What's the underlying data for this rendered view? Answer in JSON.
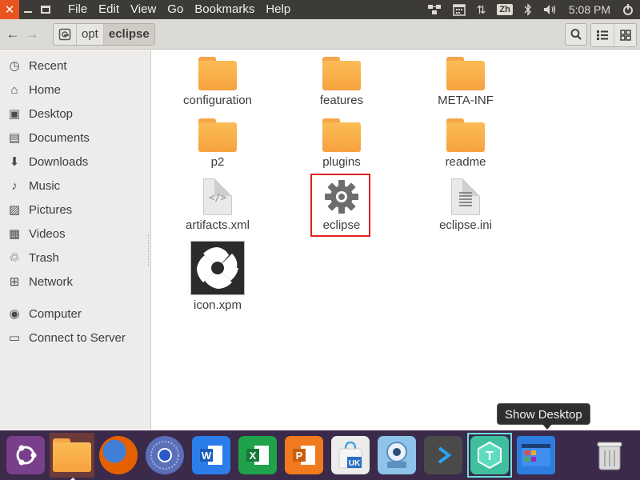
{
  "topbar": {
    "menu": [
      "File",
      "Edit",
      "View",
      "Go",
      "Bookmarks",
      "Help"
    ],
    "input_method": "Zh",
    "clock": "5:08 PM"
  },
  "toolbar": {
    "path": [
      "opt",
      "eclipse"
    ]
  },
  "sidebar": {
    "places": [
      {
        "label": "Recent",
        "icon": "clock-icon"
      },
      {
        "label": "Home",
        "icon": "home-icon"
      },
      {
        "label": "Desktop",
        "icon": "desktop-icon"
      },
      {
        "label": "Documents",
        "icon": "documents-icon"
      },
      {
        "label": "Downloads",
        "icon": "download-icon"
      },
      {
        "label": "Music",
        "icon": "music-icon"
      },
      {
        "label": "Pictures",
        "icon": "pictures-icon"
      },
      {
        "label": "Videos",
        "icon": "videos-icon"
      },
      {
        "label": "Trash",
        "icon": "trash-icon"
      },
      {
        "label": "Network",
        "icon": "network-icon"
      }
    ],
    "devices": [
      {
        "label": "Computer",
        "icon": "computer-icon"
      },
      {
        "label": "Connect to Server",
        "icon": "server-icon"
      }
    ]
  },
  "files": [
    {
      "name": "configuration",
      "type": "folder"
    },
    {
      "name": "features",
      "type": "folder"
    },
    {
      "name": "META-INF",
      "type": "folder"
    },
    {
      "name": "p2",
      "type": "folder"
    },
    {
      "name": "plugins",
      "type": "folder"
    },
    {
      "name": "readme",
      "type": "folder"
    },
    {
      "name": "artifacts.xml",
      "type": "xml"
    },
    {
      "name": "eclipse",
      "type": "executable",
      "selected": true
    },
    {
      "name": "eclipse.ini",
      "type": "text"
    },
    {
      "name": "icon.xpm",
      "type": "image"
    }
  ],
  "dock": {
    "tooltip": "Show Desktop",
    "items": [
      {
        "name": "ubuntu-dash",
        "color": "#7a3f8a"
      },
      {
        "name": "files",
        "color": "#f5a54a"
      },
      {
        "name": "firefox",
        "color": "#e66000"
      },
      {
        "name": "chromium",
        "color": "#4a7fd6"
      },
      {
        "name": "wps-writer",
        "color": "#2b7de9"
      },
      {
        "name": "wps-spreadsheets",
        "color": "#1fa24a"
      },
      {
        "name": "wps-presentation",
        "color": "#f07a1d"
      },
      {
        "name": "ubuntu-software",
        "color": "#e8e8e8"
      },
      {
        "name": "cheese-camera",
        "color": "#7fb8e6"
      },
      {
        "name": "vscode",
        "color": "#4a4a4a"
      },
      {
        "name": "taskbar-app",
        "color": "#3fbf9f"
      },
      {
        "name": "show-desktop",
        "color": "#2d7de0"
      },
      {
        "name": "trash",
        "color": "#d9d9d9"
      }
    ]
  }
}
